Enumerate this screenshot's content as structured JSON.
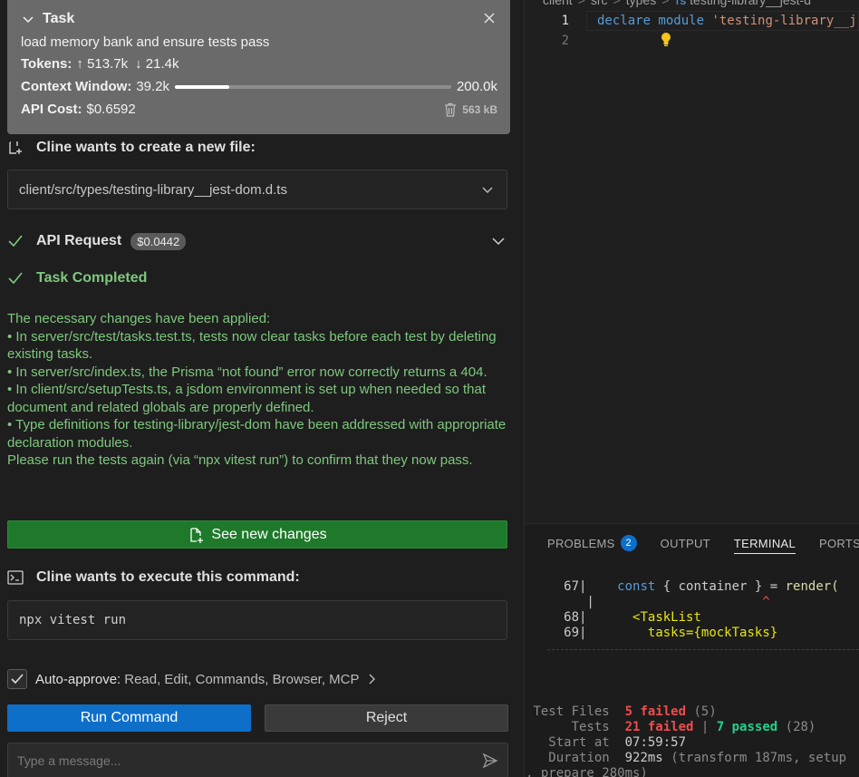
{
  "task": {
    "title": "Task",
    "description": "load memory bank and ensure tests pass",
    "tokens_label": "Tokens:",
    "tokens_up": "↑ 513.7k",
    "tokens_down": "↓ 21.4k",
    "context_label": "Context Window:",
    "context_used": "39.2k",
    "context_max": "200.0k",
    "context_fraction": 0.196,
    "cost_label": "API Cost:",
    "cost_value": "$0.6592",
    "storage_size": "563 kB"
  },
  "new_file": {
    "heading": "Cline wants to create a new file:",
    "path": "client/src/types/testing-library__jest-dom.d.ts"
  },
  "api_request": {
    "label": "API Request",
    "cost": "$0.0442"
  },
  "task_completed": {
    "label": "Task Completed",
    "lines": [
      "The necessary changes have been applied:",
      "• In server/src/test/tasks.test.ts, tests now clear tasks before each test by deleting existing tasks.",
      "• In server/src/index.ts, the Prisma “not found” error now correctly returns a 404.",
      "• In client/src/setupTests.ts, a jsdom environment is set up when needed so that document and related globals are properly defined.",
      "• Type definitions for testing-library/jest-dom have been addressed with appropriate declaration modules.",
      "Please run the tests again (via “npx vitest run”) to confirm that they now pass."
    ]
  },
  "see_changes_label": "See new changes",
  "command": {
    "heading": "Cline wants to execute this command:",
    "text": "npx vitest run"
  },
  "auto_approve": {
    "label": "Auto-approve:",
    "items": "Read, Edit, Commands, Browser, MCP"
  },
  "buttons": {
    "run": "Run Command",
    "reject": "Reject"
  },
  "message_input": {
    "placeholder": "Type a message..."
  },
  "editor": {
    "breadcrumb": [
      "client",
      "src",
      "types",
      "testing-library__jest-d"
    ],
    "lines": [
      {
        "num": "1",
        "keyword": "declare module",
        "string": "'testing-library__j"
      },
      {
        "num": "2"
      }
    ]
  },
  "panel": {
    "tabs": [
      "PROBLEMS",
      "OUTPUT",
      "TERMINAL",
      "PORTS"
    ],
    "problems_count": "2",
    "active_tab": "TERMINAL"
  },
  "terminal": {
    "line67_num": "67|",
    "line67_kw": "const",
    "line67_mid": " { container } = ",
    "line67_fn": "render(",
    "caret": "^",
    "line68_num": "68|",
    "line68_tag": "<TaskList",
    "line69_num": "69|",
    "line69_attr": "tasks={mockTasks}",
    "test_files_label": "Test Files",
    "test_files_failed": "5 failed",
    "test_files_total": "(5)",
    "tests_label": "Tests",
    "tests_failed": "21 failed",
    "tests_sep": "|",
    "tests_passed": "7 passed",
    "tests_total": "(28)",
    "start_label": "Start at",
    "start_value": "07:59:57",
    "duration_label": "Duration",
    "duration_value": "922ms",
    "duration_detail": "(transform 187ms, setup",
    "duration_detail2": ", prepare 280ms)"
  }
}
